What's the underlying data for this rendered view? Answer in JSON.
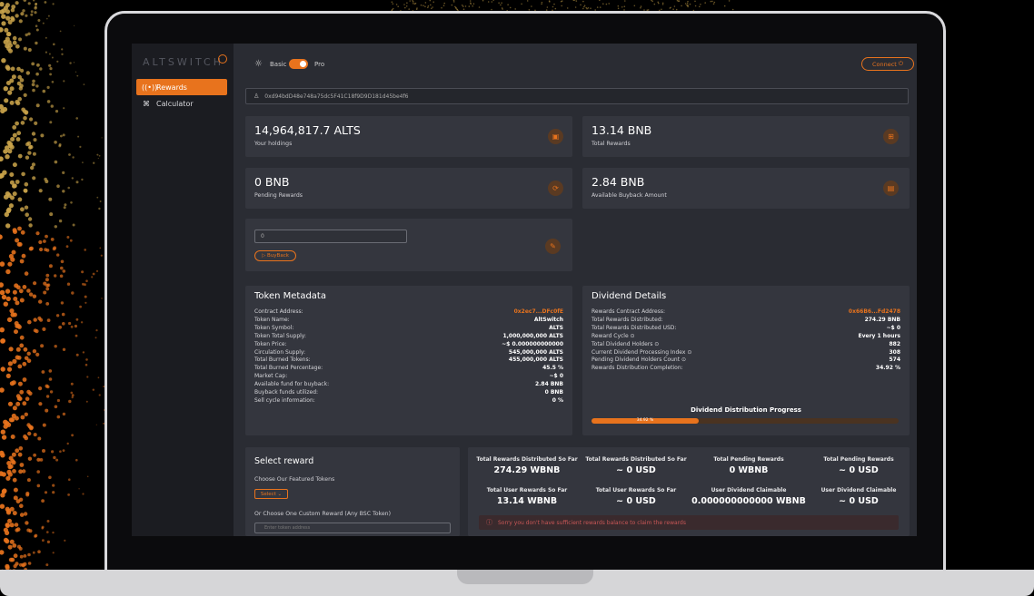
{
  "sidebar": {
    "logo": "ALTSWITCH",
    "items": [
      {
        "label": "Rewards",
        "icon": "broadcast-icon",
        "glyph": "((•))",
        "active": true
      },
      {
        "label": "Calculator",
        "icon": "command-icon",
        "glyph": "⌘",
        "active": false
      }
    ]
  },
  "topbar": {
    "mode_basic": "Basic",
    "mode_pro": "Pro",
    "connect_label": "Connect",
    "pro_enabled": true
  },
  "address": {
    "value": "0xd94bdD48e748a75dc5F41C18f9D9D181d45be4f6"
  },
  "stats_cards": [
    {
      "value": "14,964,817.7 ALTS",
      "label": "Your holdings",
      "icon": "wallet-icon",
      "glyph": "▣"
    },
    {
      "value": "13.14 BNB",
      "label": "Total Rewards",
      "icon": "gift-icon",
      "glyph": "⊞"
    },
    {
      "value": "0 BNB",
      "label": "Pending Rewards",
      "icon": "refresh-icon",
      "glyph": "⟳"
    },
    {
      "value": "2.84 BNB",
      "label": "Available Buyback Amount",
      "icon": "database-icon",
      "glyph": "▤"
    }
  ],
  "buyback": {
    "input_value": "0",
    "button_label": "BuyBack",
    "button_icon": "▷",
    "tag_glyph": "✎"
  },
  "token_metadata": {
    "title": "Token Metadata",
    "rows": [
      {
        "k": "Contract Address:",
        "v": "0x2ec7...DFc0fE",
        "accent": true
      },
      {
        "k": "Token Name:",
        "v": "AltSwitch"
      },
      {
        "k": "Token Symbol:",
        "v": "ALTS"
      },
      {
        "k": "Token Total Supply:",
        "v": "1,000,000,000 ALTS"
      },
      {
        "k": "Token Price:",
        "v": "~$ 0.000000000000"
      },
      {
        "k": "Circulation Supply:",
        "v": "545,000,000 ALTS"
      },
      {
        "k": "Total Burned Tokens:",
        "v": "455,000,000 ALTS"
      },
      {
        "k": "Total Burned Percentage:",
        "v": "45.5 %"
      },
      {
        "k": "Market Cap:",
        "v": "~$ 0"
      },
      {
        "k": "Available fund for buyback:",
        "v": "2.84 BNB"
      },
      {
        "k": "Buyback funds utilized:",
        "v": "0 BNB"
      },
      {
        "k": "Sell cycle information:",
        "v": "0 %"
      }
    ]
  },
  "dividend": {
    "title": "Dividend Details",
    "rows": [
      {
        "k": "Rewards Contract Address:",
        "v": "0x66B6...Fd2478",
        "accent": true
      },
      {
        "k": "Total Rewards Distributed:",
        "v": "274.29 BNB"
      },
      {
        "k": "Total Rewards Distributed USD:",
        "v": "~$ 0"
      },
      {
        "k": "Reward Cycle ⊙",
        "v": "Every 1 hours"
      },
      {
        "k": "Total Dividend Holders ⊙",
        "v": "882"
      },
      {
        "k": "Current Dividend Processing Index ⊙",
        "v": "308"
      },
      {
        "k": "Pending Dividend Holders Count ⊙",
        "v": "574"
      },
      {
        "k": "Rewards Distribution Completion:",
        "v": "34.92 %"
      }
    ],
    "progress_title": "Dividend Distribution Progress",
    "progress_text": "34.92 %",
    "progress_fraction": 0.3492
  },
  "select_reward": {
    "title": "Select reward",
    "featured_label": "Choose Our Featured Tokens",
    "select_label": "Select",
    "custom_label": "Or Choose One Custom Reward (Any BSC Token)",
    "token_placeholder": "Enter token address"
  },
  "summary": [
    {
      "h": "Total Rewards Distributed So Far",
      "n": "274.29 WBNB"
    },
    {
      "h": "Total Rewards Distributed So Far",
      "n": "~ 0 USD"
    },
    {
      "h": "Total Pending Rewards",
      "n": "0 WBNB"
    },
    {
      "h": "Total Pending Rewards",
      "n": "~ 0 USD"
    },
    {
      "h": "Total User Rewards So Far",
      "n": "13.14 WBNB"
    },
    {
      "h": "Total User Rewards So Far",
      "n": "~ 0 USD"
    },
    {
      "h": "User Dividend Claimable",
      "n": "0.000000000000 WBNB"
    },
    {
      "h": "User Dividend Claimable",
      "n": "~ 0 USD"
    }
  ],
  "alert": {
    "text": "Sorry you don't have sufficient rewards balance to claim the rewards",
    "icon": "ⓘ"
  },
  "colors": {
    "accent": "#e8731d",
    "panel": "#34363e",
    "background": "#2a2c33",
    "sidebar": "#1b1c21",
    "error": "#c95757"
  }
}
